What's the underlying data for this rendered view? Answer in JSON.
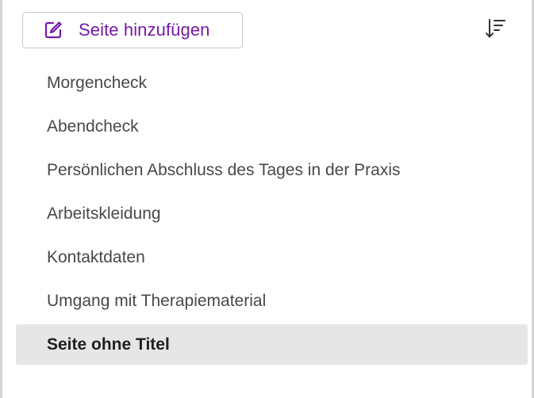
{
  "toolbar": {
    "add_page_label": "Seite hinzufügen",
    "add_page_icon": "compose-icon",
    "sort_icon": "sort-descending-icon"
  },
  "colors": {
    "accent": "#7719aa",
    "selected_bg": "#e6e6e6",
    "text": "#484848"
  },
  "pages": [
    {
      "title": "Morgencheck",
      "selected": false
    },
    {
      "title": "Abendcheck",
      "selected": false
    },
    {
      "title": "Persönlichen Abschluss des Tages in der Praxis",
      "selected": false
    },
    {
      "title": "Arbeitskleidung",
      "selected": false
    },
    {
      "title": "Kontaktdaten",
      "selected": false
    },
    {
      "title": "Umgang mit Therapiematerial",
      "selected": false
    },
    {
      "title": "Seite ohne Titel",
      "selected": true
    }
  ]
}
